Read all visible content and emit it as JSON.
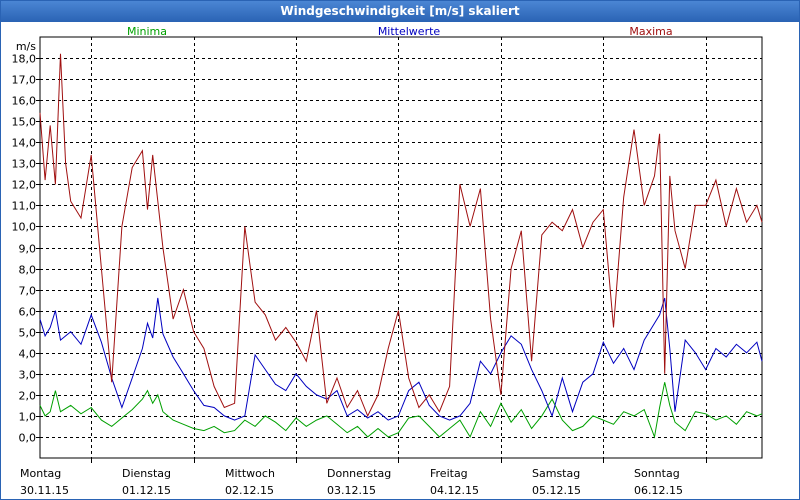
{
  "window": {
    "title": "Windgeschwindigkeit [m/s] skaliert"
  },
  "chart_data": {
    "type": "line",
    "title": "Windgeschwindigkeit [m/s] skaliert",
    "ylabel": "m/s",
    "ylim": [
      -1,
      19
    ],
    "yticks": [
      "0,0",
      "1,0",
      "2,0",
      "3,0",
      "4,0",
      "5,0",
      "6,0",
      "7,0",
      "8,0",
      "9,0",
      "10,0",
      "11,0",
      "12,0",
      "13,0",
      "14,0",
      "15,0",
      "16,0",
      "17,0",
      "18,0"
    ],
    "xlim": [
      0,
      7.05
    ],
    "grid": true,
    "day_labels": [
      {
        "day": "Montag",
        "date": "30.11.15"
      },
      {
        "day": "Dienstag",
        "date": "01.12.15"
      },
      {
        "day": "Mittwoch",
        "date": "02.12.15"
      },
      {
        "day": "Donnerstag",
        "date": "03.12.15"
      },
      {
        "day": "Freitag",
        "date": "04.12.15"
      },
      {
        "day": "Samstag",
        "date": "05.12.15"
      },
      {
        "day": "Sonntag",
        "date": "06.12.15"
      }
    ],
    "legend_position": "top",
    "series": [
      {
        "name": "Minima",
        "color": "#00a000",
        "x": [
          0.0,
          0.05,
          0.1,
          0.15,
          0.2,
          0.3,
          0.4,
          0.5,
          0.6,
          0.7,
          0.8,
          0.9,
          1.0,
          1.05,
          1.1,
          1.15,
          1.2,
          1.3,
          1.4,
          1.5,
          1.6,
          1.7,
          1.8,
          1.9,
          2.0,
          2.1,
          2.2,
          2.3,
          2.4,
          2.5,
          2.6,
          2.7,
          2.8,
          2.9,
          3.0,
          3.1,
          3.2,
          3.3,
          3.4,
          3.5,
          3.6,
          3.7,
          3.8,
          3.9,
          4.0,
          4.1,
          4.2,
          4.3,
          4.4,
          4.5,
          4.6,
          4.7,
          4.8,
          4.9,
          5.0,
          5.1,
          5.2,
          5.3,
          5.4,
          5.5,
          5.6,
          5.7,
          5.8,
          5.9,
          6.0,
          6.05,
          6.1,
          6.15,
          6.2,
          6.3,
          6.4,
          6.5,
          6.6,
          6.7,
          6.8,
          6.9,
          7.0,
          7.05
        ],
        "values": [
          1.5,
          1.0,
          1.2,
          2.2,
          1.2,
          1.5,
          1.1,
          1.4,
          0.8,
          0.5,
          0.9,
          1.3,
          1.8,
          2.2,
          1.6,
          2.0,
          1.2,
          0.8,
          0.6,
          0.4,
          0.3,
          0.5,
          0.2,
          0.3,
          0.8,
          0.5,
          1.0,
          0.7,
          0.3,
          0.9,
          0.5,
          0.8,
          1.0,
          0.6,
          0.2,
          0.5,
          0.0,
          0.4,
          0.0,
          0.2,
          0.9,
          1.0,
          0.5,
          0.0,
          0.4,
          0.8,
          0.0,
          1.2,
          0.5,
          1.6,
          0.7,
          1.3,
          0.4,
          1.0,
          1.8,
          0.8,
          0.3,
          0.5,
          1.0,
          0.8,
          0.6,
          1.2,
          1.0,
          1.3,
          0.0,
          1.4,
          2.6,
          1.5,
          0.7,
          0.3,
          1.2,
          1.1,
          0.8,
          1.0,
          0.6,
          1.2,
          1.0,
          1.1
        ]
      },
      {
        "name": "Mittelwerte",
        "color": "#0000c0",
        "x": [
          0.0,
          0.05,
          0.1,
          0.15,
          0.2,
          0.3,
          0.4,
          0.5,
          0.6,
          0.7,
          0.8,
          0.9,
          1.0,
          1.05,
          1.1,
          1.15,
          1.2,
          1.3,
          1.4,
          1.5,
          1.6,
          1.7,
          1.8,
          1.9,
          2.0,
          2.1,
          2.2,
          2.3,
          2.4,
          2.5,
          2.6,
          2.7,
          2.8,
          2.9,
          3.0,
          3.1,
          3.2,
          3.3,
          3.4,
          3.5,
          3.6,
          3.7,
          3.8,
          3.9,
          4.0,
          4.1,
          4.2,
          4.3,
          4.4,
          4.5,
          4.6,
          4.7,
          4.8,
          4.9,
          5.0,
          5.1,
          5.2,
          5.3,
          5.4,
          5.5,
          5.6,
          5.7,
          5.8,
          5.9,
          6.0,
          6.05,
          6.1,
          6.15,
          6.2,
          6.3,
          6.4,
          6.5,
          6.6,
          6.7,
          6.8,
          6.9,
          7.0,
          7.05
        ],
        "values": [
          5.6,
          4.8,
          5.2,
          6.0,
          4.6,
          5.0,
          4.4,
          5.8,
          4.5,
          2.8,
          1.4,
          2.8,
          4.2,
          5.4,
          4.7,
          6.6,
          4.9,
          3.8,
          3.0,
          2.2,
          1.5,
          1.4,
          1.0,
          0.8,
          1.0,
          3.9,
          3.2,
          2.5,
          2.2,
          3.0,
          2.4,
          2.0,
          1.8,
          2.2,
          1.0,
          1.3,
          0.9,
          1.2,
          0.8,
          1.0,
          2.2,
          2.6,
          1.5,
          1.0,
          0.8,
          1.0,
          1.6,
          3.6,
          3.0,
          4.0,
          4.8,
          4.4,
          3.2,
          2.2,
          1.0,
          2.8,
          1.2,
          2.6,
          3.0,
          4.5,
          3.5,
          4.2,
          3.2,
          4.6,
          5.4,
          5.8,
          6.6,
          4.2,
          1.2,
          4.6,
          4.0,
          3.2,
          4.2,
          3.8,
          4.4,
          4.0,
          4.5,
          3.6
        ]
      },
      {
        "name": "Maxima",
        "color": "#a01010",
        "x": [
          0.0,
          0.05,
          0.1,
          0.15,
          0.2,
          0.25,
          0.3,
          0.4,
          0.5,
          0.6,
          0.7,
          0.8,
          0.9,
          1.0,
          1.05,
          1.1,
          1.15,
          1.2,
          1.3,
          1.4,
          1.5,
          1.6,
          1.7,
          1.8,
          1.9,
          2.0,
          2.05,
          2.1,
          2.2,
          2.3,
          2.4,
          2.5,
          2.6,
          2.7,
          2.8,
          2.9,
          3.0,
          3.1,
          3.2,
          3.3,
          3.4,
          3.5,
          3.6,
          3.7,
          3.8,
          3.9,
          4.0,
          4.1,
          4.2,
          4.3,
          4.4,
          4.5,
          4.6,
          4.7,
          4.8,
          4.9,
          5.0,
          5.1,
          5.2,
          5.3,
          5.4,
          5.5,
          5.6,
          5.7,
          5.8,
          5.9,
          6.0,
          6.05,
          6.1,
          6.15,
          6.2,
          6.3,
          6.4,
          6.5,
          6.6,
          6.7,
          6.8,
          6.9,
          7.0,
          7.05
        ],
        "values": [
          15.4,
          12.2,
          14.8,
          12.0,
          18.2,
          13.0,
          11.2,
          10.4,
          13.4,
          8.0,
          2.6,
          10.0,
          12.8,
          13.6,
          10.8,
          13.4,
          11.2,
          9.0,
          5.6,
          7.0,
          5.0,
          4.2,
          2.4,
          1.4,
          1.6,
          10.0,
          8.2,
          6.4,
          5.8,
          4.6,
          5.2,
          4.5,
          3.6,
          6.0,
          1.6,
          2.8,
          1.4,
          2.2,
          1.0,
          2.0,
          4.2,
          6.0,
          2.8,
          1.4,
          2.0,
          1.2,
          2.4,
          12.0,
          10.0,
          11.8,
          5.6,
          2.0,
          8.0,
          9.8,
          3.6,
          9.6,
          10.2,
          9.8,
          10.8,
          9.0,
          10.2,
          10.8,
          5.2,
          11.4,
          14.6,
          11.0,
          12.4,
          14.4,
          3.0,
          12.4,
          9.8,
          8.0,
          11.0,
          11.0,
          12.2,
          10.0,
          11.8,
          10.2,
          11.0,
          10.2
        ]
      }
    ]
  }
}
